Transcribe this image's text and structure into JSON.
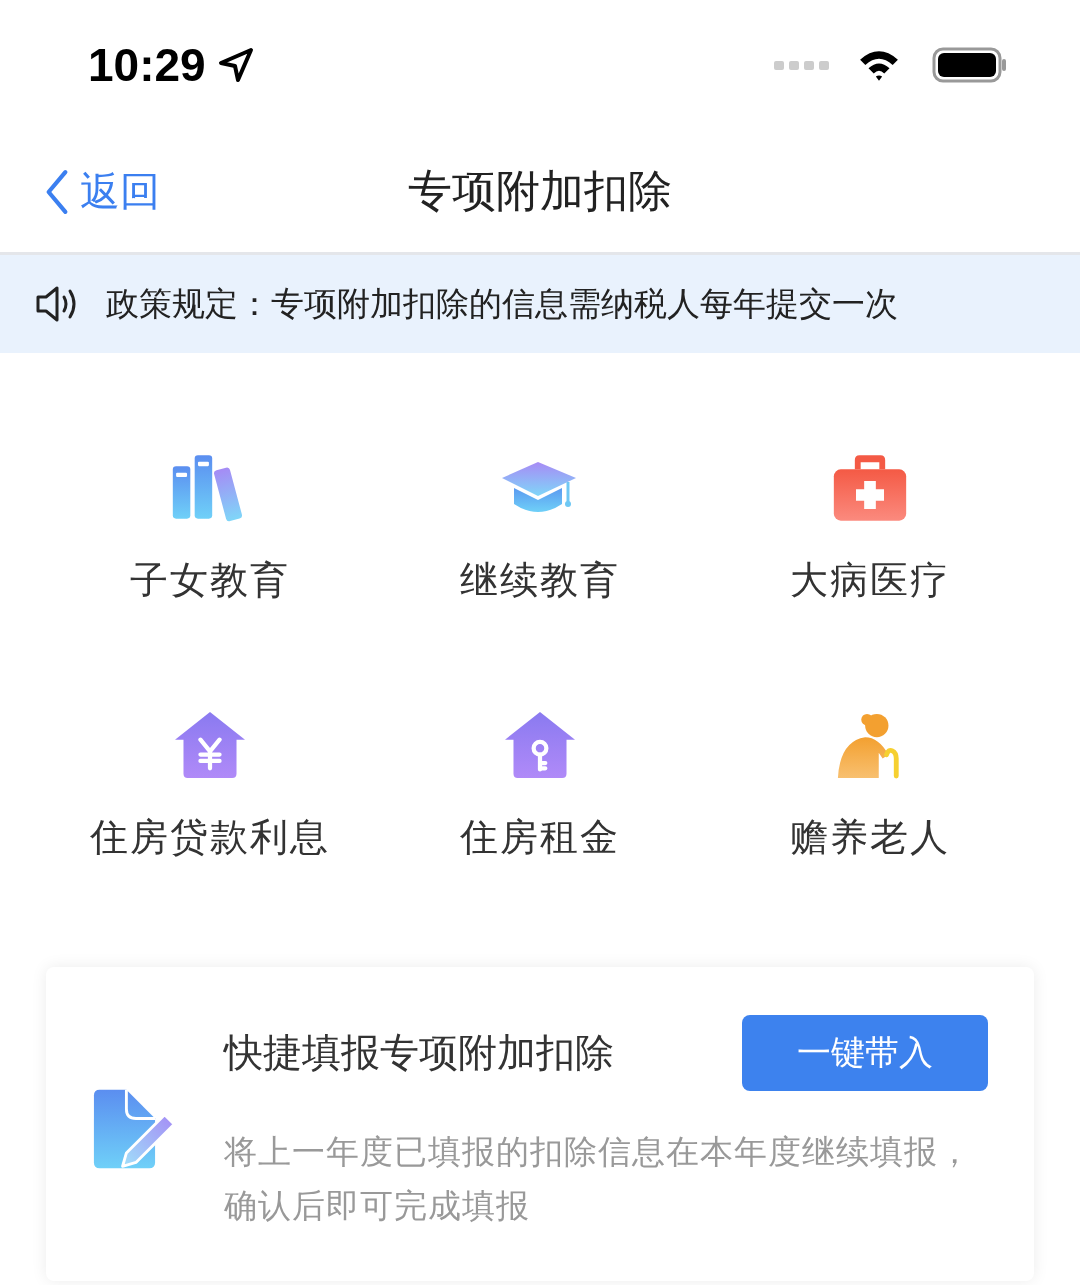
{
  "status_bar": {
    "time": "10:29"
  },
  "nav": {
    "back": "返回",
    "title": "专项附加扣除"
  },
  "notice": {
    "text": "政策规定：专项附加扣除的信息需纳税人每年提交一次"
  },
  "items": [
    {
      "kind": "books",
      "label": "子女教育"
    },
    {
      "kind": "cap",
      "label": "继续教育"
    },
    {
      "kind": "medkit",
      "label": "大病医疗"
    },
    {
      "kind": "house-yen",
      "label": "住房贷款利息"
    },
    {
      "kind": "house-key",
      "label": "住房租金"
    },
    {
      "kind": "elder",
      "label": "赡养老人"
    }
  ],
  "quick_card": {
    "title": "快捷填报专项附加扣除",
    "button": "一键带入",
    "description": "将上一年度已填报的扣除信息在本年度继续填报，确认后即可完成填报"
  }
}
